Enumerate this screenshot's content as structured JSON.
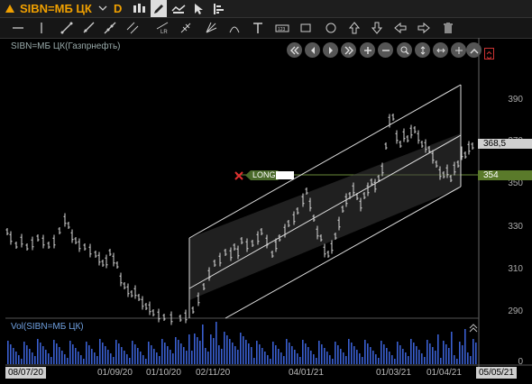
{
  "toolbar": {
    "ticker": "SIBN=МБ ЦК",
    "period": "D"
  },
  "chart": {
    "title": "SIBN=МБ ЦК(Газпрнефть)",
    "volume_title": "Vol(SIBN=МБ ЦК)",
    "price_ticks": [
      "390",
      "370",
      "350",
      "330",
      "310",
      "290"
    ],
    "volume_ticks": [
      "0"
    ],
    "current_price": "368,5",
    "line_price": "354",
    "long_label": "LONG",
    "x_labels": [
      "08/07/20",
      "01/09/20",
      "01/10/20",
      "02/11/20",
      "04/01/21",
      "01/03/21",
      "01/04/21",
      "05/05/21"
    ],
    "colors": {
      "accent": "#f0a000",
      "price_box": "#cfcfcf",
      "line_tag": "#5a7a2a",
      "volume": "#3a5fd0",
      "candles": "#d8d8d8"
    }
  },
  "chart_data": {
    "type": "ohlc",
    "ylim": [
      280,
      400
    ],
    "series": [
      {
        "name": "SIBN=МБ ЦК(Газпрнефть)"
      }
    ],
    "y_ticks": [
      290,
      310,
      330,
      350,
      370,
      390
    ],
    "last_close": 368.5,
    "horizontal_line": 354,
    "x_labels": [
      "08/07/20",
      "01/09/20",
      "01/10/20",
      "02/11/20",
      "04/01/21",
      "01/03/21",
      "01/04/21",
      "05/05/21"
    ]
  }
}
